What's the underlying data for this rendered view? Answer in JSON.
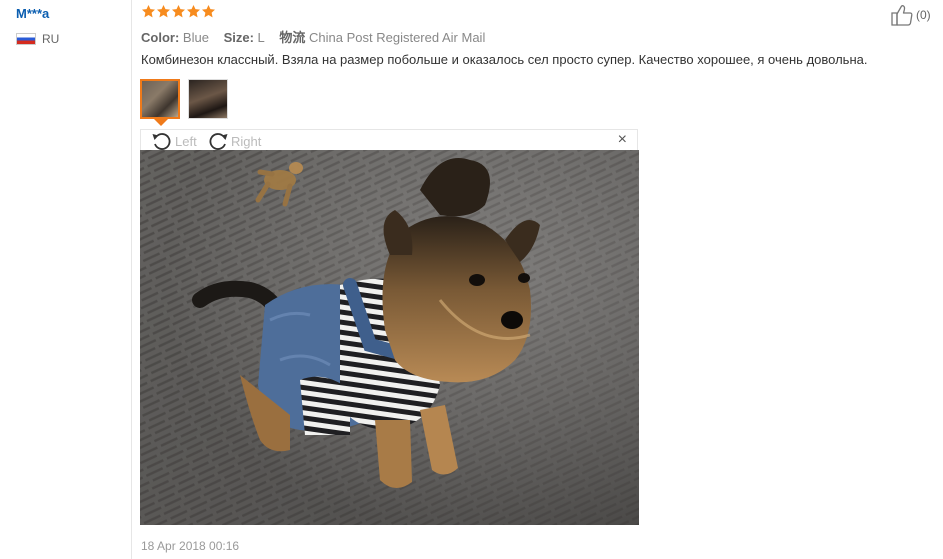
{
  "reviewer": {
    "name": "M***a",
    "country": "RU"
  },
  "rating": {
    "stars": 5,
    "max": 5,
    "color": "#f78c1f"
  },
  "meta": {
    "color_label": "Color:",
    "color_value": "Blue",
    "size_label": "Size:",
    "size_value": "L",
    "shipping_label": "物流",
    "shipping_value": "China Post Registered Air Mail"
  },
  "review_text": "Комбинезон классный. Взяла на размер побольше и оказалось сел просто супер. Качество хорошее, я очень довольна.",
  "helpful": {
    "count": "(0)"
  },
  "viewer": {
    "rotate_left_label": "Left",
    "rotate_right_label": "Right",
    "close_glyph": "×"
  },
  "date": "18 Apr 2018 00:16",
  "colors": {
    "accent_orange": "#ef7a1a",
    "name_blue": "#0b5eb0"
  }
}
